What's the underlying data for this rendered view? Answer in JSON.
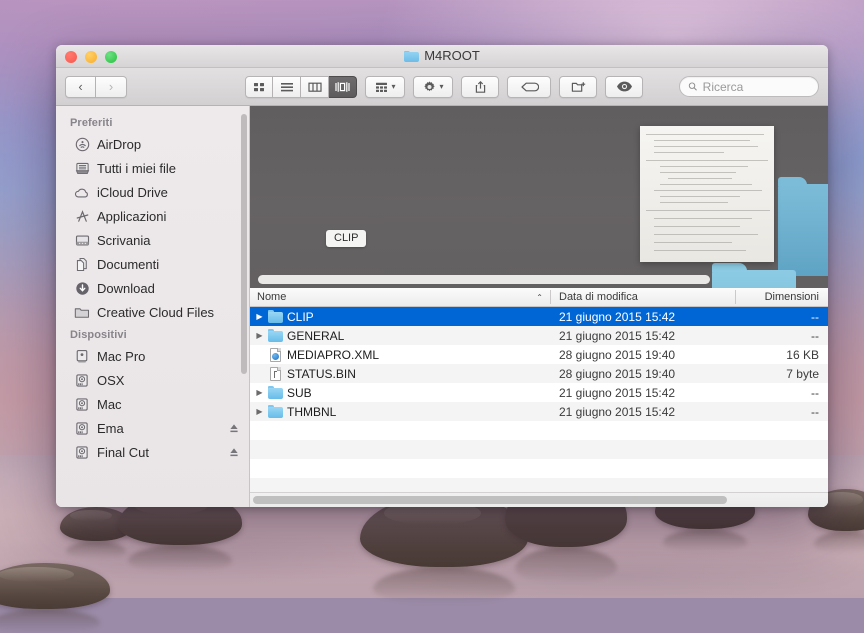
{
  "window": {
    "title": "M4ROOT",
    "title_icon": "folder-icon",
    "traffic_lights": {
      "close": "close-button",
      "minimize": "minimize-button",
      "zoom": "zoom-button",
      "close_color": "#f9564b",
      "minimize_color": "#f9ad24",
      "zoom_color": "#24c03d"
    }
  },
  "toolbar": {
    "back_glyph": "‹",
    "forward_glyph": "›",
    "view_buttons": [
      {
        "name": "icon-view",
        "icon": "grid-icon",
        "active": false
      },
      {
        "name": "list-view",
        "icon": "list-icon",
        "active": false
      },
      {
        "name": "column-view",
        "icon": "columns-icon",
        "active": false
      },
      {
        "name": "coverflow-view",
        "icon": "coverflow-icon",
        "active": true
      }
    ],
    "arrange_icon": "arrange-icon",
    "action_icon": "gear-icon",
    "share_icon": "share-icon",
    "tag_icon": "tag-icon",
    "newfolder_icon": "new-folder-icon",
    "quicklook_icon": "eye-icon",
    "caret_glyph": "▾"
  },
  "search": {
    "placeholder": "Ricerca",
    "value": "",
    "icon": "search-icon"
  },
  "sidebar": {
    "sections": [
      {
        "header": "Preferiti",
        "items": [
          {
            "label": "AirDrop",
            "icon": "airdrop-icon",
            "eject": false
          },
          {
            "label": "Tutti i miei file",
            "icon": "all-my-files-icon",
            "eject": false
          },
          {
            "label": "iCloud Drive",
            "icon": "icloud-icon",
            "eject": false
          },
          {
            "label": "Applicazioni",
            "icon": "applications-icon",
            "eject": false
          },
          {
            "label": "Scrivania",
            "icon": "desktop-icon",
            "eject": false
          },
          {
            "label": "Documenti",
            "icon": "documents-icon",
            "eject": false
          },
          {
            "label": "Download",
            "icon": "downloads-icon",
            "eject": false
          },
          {
            "label": "Creative Cloud Files",
            "icon": "folder-icon",
            "eject": false
          }
        ]
      },
      {
        "header": "Dispositivi",
        "items": [
          {
            "label": "Mac Pro",
            "icon": "computer-icon",
            "eject": false
          },
          {
            "label": "OSX",
            "icon": "harddisk-icon",
            "eject": false
          },
          {
            "label": "Mac",
            "icon": "harddisk-icon",
            "eject": false
          },
          {
            "label": "Ema",
            "icon": "harddisk-icon",
            "eject": true
          },
          {
            "label": "Final Cut",
            "icon": "harddisk-icon",
            "eject": true
          }
        ]
      }
    ]
  },
  "coverflow": {
    "selected_label": "CLIP",
    "items": [
      {
        "name": "CLIP",
        "type": "folder"
      },
      {
        "name": "GENERAL",
        "type": "folder"
      },
      {
        "name": "MEDIAPRO.XML",
        "type": "document"
      },
      {
        "name": "STATUS.BIN",
        "type": "folder"
      },
      {
        "name": "SUB",
        "type": "folder"
      }
    ]
  },
  "columns": {
    "name": "Nome",
    "date": "Data di modifica",
    "size": "Dimensioni",
    "sort_glyph": "⌃",
    "sorted_by": "Nome"
  },
  "files": [
    {
      "name": "CLIP",
      "date": "21 giugno 2015 15:42",
      "size": "--",
      "icon": "folder-icon",
      "expandable": true,
      "selected": true
    },
    {
      "name": "GENERAL",
      "date": "21 giugno 2015 15:42",
      "size": "--",
      "icon": "folder-icon",
      "expandable": true,
      "selected": false
    },
    {
      "name": "MEDIAPRO.XML",
      "date": "28 giugno 2015 19:40",
      "size": "16 KB",
      "icon": "xml-document-icon",
      "expandable": false,
      "selected": false
    },
    {
      "name": "STATUS.BIN",
      "date": "28 giugno 2015 19:40",
      "size": "7 byte",
      "icon": "binary-document-icon",
      "expandable": false,
      "selected": false
    },
    {
      "name": "SUB",
      "date": "21 giugno 2015 15:42",
      "size": "--",
      "icon": "folder-icon",
      "expandable": true,
      "selected": false
    },
    {
      "name": "THMBNL",
      "date": "21 giugno 2015 15:42",
      "size": "--",
      "icon": "folder-icon",
      "expandable": true,
      "selected": false
    }
  ],
  "colors": {
    "selection_blue": "#0066d6",
    "folder_blue": "#6cbde8",
    "coverflow_bg": "#636061"
  }
}
